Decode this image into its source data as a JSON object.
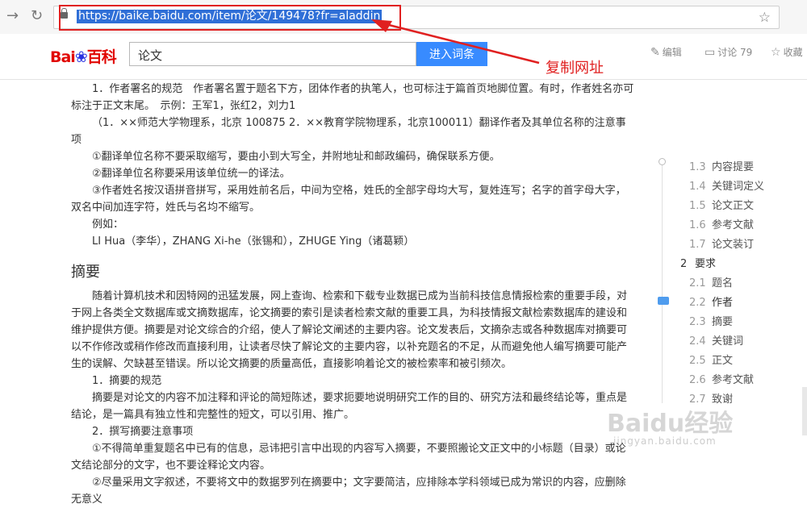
{
  "browser": {
    "url": "https://baike.baidu.com/item/论文/149478?fr=aladdin",
    "back_icon": "arrow-right-icon",
    "reload_icon": "reload-icon",
    "bookmark_icon": "star-icon"
  },
  "header": {
    "logo_left": "Bai",
    "logo_mid": "du",
    "logo_right": "百科",
    "search_value": "论文",
    "search_button": "进入词条",
    "edit_label": "编辑",
    "discuss_label": "讨论 79",
    "collect_label": "收藏"
  },
  "annotation": {
    "label": "复制网址",
    "color": "#e02020"
  },
  "article": {
    "p1": "1．作者署名的规范　作者署名置于题名下方，团体作者的执笔人，也可标注于篇首页地脚位置。有时，作者姓名亦可标注于正文末尾。　示例：王军1，张红2，刘力1",
    "p2": "（1．××师范大学物理系，北京 100875 2．××教育学院物理系，北京100011）翻译作者及其单位名称的注意事项",
    "p3": "①翻译单位名称不要采取缩写，要由小到大写全，并附地址和邮政编码，确保联系方便。",
    "p4": "②翻译单位名称要采用该单位统一的译法。",
    "p5": "③作者姓名按汉语拼音拼写，采用姓前名后，中间为空格，姓氏的全部字母均大写，复姓连写；名字的首字母大字，双名中间加连字符，姓氏与名均不缩写。",
    "p6": "例如：",
    "p7": "LI Hua（李华），ZHANG Xi-he（张锡和），ZHUGE Ying（诸葛颖）",
    "h_abstract": "摘要",
    "p8": "随着计算机技术和因特网的迅猛发展，网上查询、检索和下载专业数据已成为当前科技信息情报检索的重要手段，对于网上各类全文数据库或文摘数据库，论文摘要的索引是读者检索文献的重要工具，为科技情报文献检索数据库的建设和维护提供方便。摘要是对论文综合的介绍，使人了解论文阐述的主要内容。论文发表后，文摘杂志或各种数据库对摘要可以不作修改或稍作修改而直接利用，让读者尽快了解论文的主要内容，以补充题名的不足，从而避免他人编写摘要可能产生的误解、欠缺甚至错误。所以论文摘要的质量高低，直接影响着论文的被检索率和被引频次。",
    "s1": "1．摘要的规范",
    "p9": "摘要是对论文的内容不加注释和评论的简短陈述，要求扼要地说明研究工作的目的、研究方法和最终结论等，重点是结论，是一篇具有独立性和完整性的短文，可以引用、推广。",
    "s2": "2．撰写摘要注意事项",
    "p10": "①不得简单重复题名中已有的信息，忌讳把引言中出现的内容写入摘要，不要照搬论文正文中的小标题（目录）或论文结论部分的文字，也不要诠释论文内容。",
    "p11": "②尽量采用文字叙述，不要将文中的数据罗列在摘要中；文字要简洁，应排除本学科领域已成为常识的内容，应删除无意义"
  },
  "toc": {
    "items": [
      {
        "num": "1.3",
        "label": "内容提要"
      },
      {
        "num": "1.4",
        "label": "关键词定义"
      },
      {
        "num": "1.5",
        "label": "论文正文"
      },
      {
        "num": "1.6",
        "label": "参考文献"
      },
      {
        "num": "1.7",
        "label": "论文装订"
      },
      {
        "num": "2",
        "label": "要求"
      },
      {
        "num": "2.1",
        "label": "题名"
      },
      {
        "num": "2.2",
        "label": "作者"
      },
      {
        "num": "2.3",
        "label": "摘要"
      },
      {
        "num": "2.4",
        "label": "关键词"
      },
      {
        "num": "2.5",
        "label": "正文"
      },
      {
        "num": "2.6",
        "label": "参考文献"
      },
      {
        "num": "2.7",
        "label": "致谢"
      }
    ]
  },
  "watermark": {
    "main": "Baidu经验",
    "sub": "jingyan.baidu.com"
  }
}
